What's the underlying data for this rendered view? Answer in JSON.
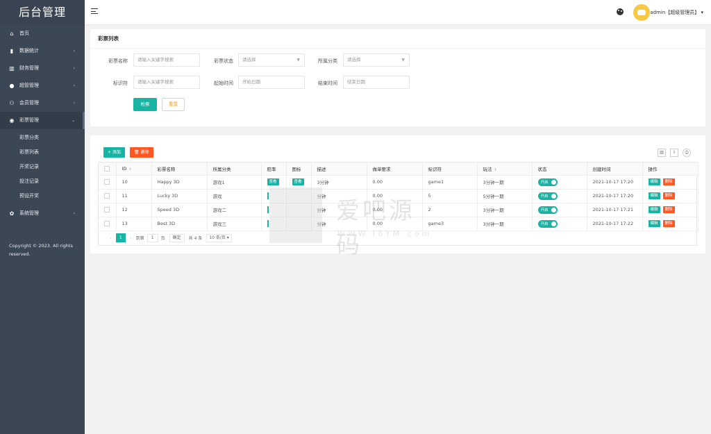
{
  "brand": "后台管理",
  "sidebar": {
    "items": [
      {
        "label": "首页",
        "icon": "home-icon",
        "glyph": "⌂",
        "arrow": ""
      },
      {
        "label": "数据统计",
        "icon": "bar-chart-icon",
        "glyph": "▮",
        "arrow": "›"
      },
      {
        "label": "财务管理",
        "icon": "bank-icon",
        "glyph": "▥",
        "arrow": "›"
      },
      {
        "label": "超管管理",
        "icon": "user-icon",
        "glyph": "●",
        "arrow": "›"
      },
      {
        "label": "会员管理",
        "icon": "users-icon",
        "glyph": "⚇",
        "arrow": "›"
      },
      {
        "label": "彩票管理",
        "icon": "gamepad-icon",
        "glyph": "◉",
        "arrow": "⌄"
      },
      {
        "label": "系统管理",
        "icon": "gear-icon",
        "glyph": "✿",
        "arrow": "›"
      }
    ],
    "sub_items": [
      "彩票分类",
      "彩票列表",
      "开奖记录",
      "投注记录",
      "预设开奖"
    ],
    "copyright": "Copyright © 2023. All rights reserved."
  },
  "header": {
    "user": "admin【超级管理员】 ▾"
  },
  "search_panel": {
    "title": "彩票列表",
    "name_label": "彩票名称",
    "name_placeholder": "请输入关键字搜索",
    "status_label": "彩票状态",
    "status_value": "请选择",
    "category_label": "所属分类",
    "category_value": "请选择",
    "code_label": "标识符",
    "code_placeholder": "请输入关键字搜索",
    "start_label": "起始时间",
    "start_placeholder": "开始日期",
    "end_label": "结束时间",
    "end_placeholder": "结束日期",
    "search_button": "检索",
    "reset_button": "重置"
  },
  "table_panel": {
    "add_button": "+ 添加",
    "delete_button": "🗑 删除",
    "columns": [
      "ID",
      "彩票名称",
      "所属分类",
      "赔率",
      "图标",
      "描述",
      "做单要求",
      "标识符",
      "玩法",
      "状态",
      "创建时间",
      "操作"
    ],
    "view_label": "查看",
    "toggle_label": "开启",
    "edit_label": "编辑",
    "row_delete_label": "删除",
    "rows": [
      {
        "id": "10",
        "name": "Happy 3D",
        "category": "游戏1",
        "desc": "3分钟",
        "requirement": "0.00",
        "code": "game1",
        "play": "3分钟一期",
        "created": "2021-10-17 17:20"
      },
      {
        "id": "11",
        "name": "Lucky 3D",
        "category": "游戏",
        "desc": "分钟",
        "requirement": "0.00",
        "code": "5",
        "play": "5分钟一期",
        "created": "2021-10-17 17:20"
      },
      {
        "id": "12",
        "name": "Speed 3D",
        "category": "游戏二",
        "desc": "分钟",
        "requirement": "0.00",
        "code": "2",
        "play": "3分钟一期",
        "created": "2021-10-17 17:21"
      },
      {
        "id": "13",
        "name": "Best 3D",
        "category": "游戏三",
        "desc": "分钟",
        "requirement": "0.00",
        "code": "game3",
        "play": "3分钟一期",
        "created": "2021-10-17 17:22"
      }
    ],
    "pager": {
      "current": "1",
      "goto_label": "到第",
      "goto_value": "1",
      "page_unit": "页",
      "confirm": "确定",
      "total": "共 4 条",
      "per_page": "10 条/页 ▾"
    }
  },
  "watermark": {
    "text": "爱吧源码",
    "sub": "WWW.I8YM.com"
  }
}
